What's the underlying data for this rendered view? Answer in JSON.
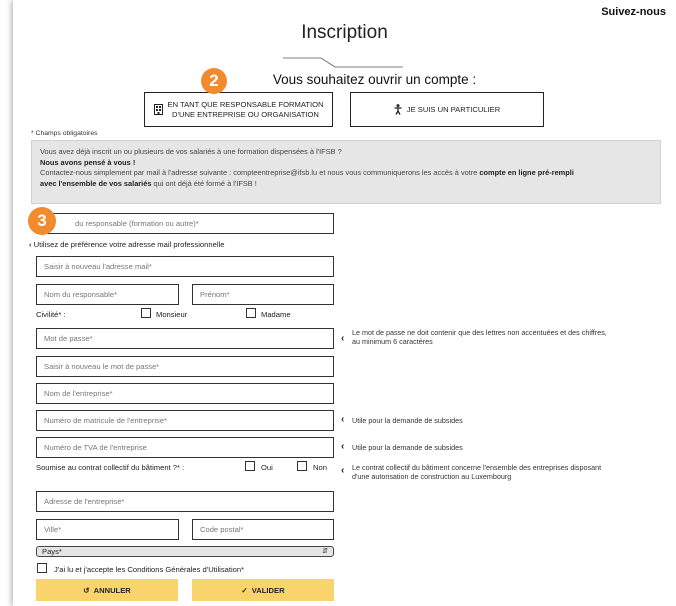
{
  "header": {
    "follow_label": "Suivez-nous",
    "title": "Inscription",
    "subtitle": "Vous souhaitez ouvrir un compte :"
  },
  "account_types": {
    "company_label_line1": "EN TANT QUE RESPONSABLE FORMATION",
    "company_label_line2": "D'UNE ENTREPRISE OU ORGANISATION",
    "company_icon": "building-icon",
    "individual_label": "JE SUIS UN PARTICULIER",
    "individual_icon": "person-icon"
  },
  "badges": {
    "step2": "2",
    "step3": "3"
  },
  "required_note": "* Champs obligatoires",
  "info": {
    "line1": "Vous avez déjà inscrit un ou plusieurs de vos salariés à une formation dispensées à l'IFSB ?",
    "line2": "Nous avons pensé à vous !",
    "line3a": "Contactez-nous simplement par mail à l'adresse suivante : compteentreprise@ifsb.lu et nous vous communiquerons les accès à votre ",
    "line3b": "compte en ligne pré-rempli",
    "line4a": "avec l'ensemble de vos salariés",
    "line4b": " qui ont déjà été formé à l'IFSB !"
  },
  "form": {
    "email_placeholder": "du responsable (formation ou autre)*",
    "email_hint": "Utilisez de préférence votre adresse mail professionnelle",
    "email_confirm_placeholder": "Saisir à nouveau l'adresse mail*",
    "lastname_placeholder": "Nom du responsable*",
    "firstname_placeholder": "Prénom*",
    "civility_label": "Civilité* :",
    "civility_options": [
      "Monsieur",
      "Madame"
    ],
    "password_placeholder": "Mot de passe*",
    "password_hint_line1": "Le mot de passe ne doit contenir que des lettres non accentuées et des chiffres,",
    "password_hint_line2": "au minimum 6 caractères",
    "password_confirm_placeholder": "Saisir à nouveau le mot de passe*",
    "company_name_placeholder": "Nom de l'entreprise*",
    "matricule_placeholder": "Numéro de matricule de l'entreprise*",
    "matricule_hint": "Utile pour la demande de subsides",
    "tva_placeholder": "Numéro de TVA de l'entreprise",
    "tva_hint": "Utile pour la demande de subsides",
    "contract_label": "Soumise au contrat collectif du bâtiment ?* :",
    "contract_options": [
      "Oui",
      "Non"
    ],
    "contract_hint_line1": "Le contrat collectif du bâtiment concerne l'ensemble des entreprises disposant",
    "contract_hint_line2": "d'une autorisation de construction au Luxembourg",
    "address_placeholder": "Adresse de l'entreprise*",
    "city_placeholder": "Ville*",
    "postal_placeholder": "Code postal*",
    "country_selected": "Pays*",
    "terms_label": "J'ai lu et j'accepte les Conditions Générales d'Utilisation*"
  },
  "actions": {
    "cancel_label": "ANNULER",
    "validate_label": "VALIDER"
  },
  "colors": {
    "accent_orange": "#f28a2e",
    "button_yellow": "#f9d36b",
    "info_gray": "#e6e6e6"
  }
}
